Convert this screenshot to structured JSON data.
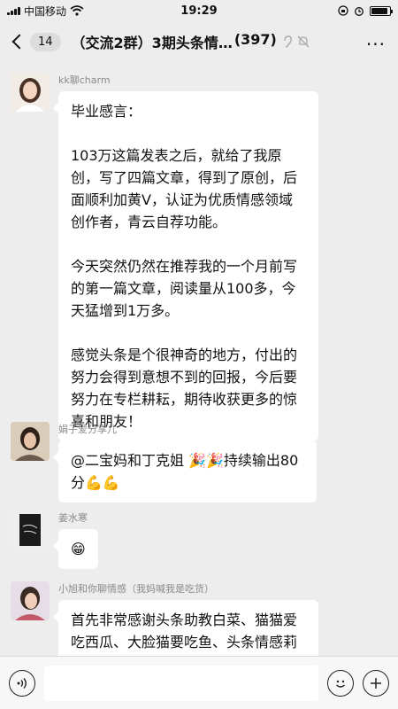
{
  "status_bar": {
    "carrier": "中国移动",
    "time": "19:29",
    "battery_percent": 90
  },
  "nav": {
    "unread_count": "14",
    "chat_title": "（交流2群）3期头条情…",
    "member_count": "(397)",
    "more_label": "···"
  },
  "messages": [
    {
      "sender": "kk聊charm",
      "text": "毕业感言：\n\n103万这篇发表之后，就给了我原创，写了四篇文章，得到了原创，后面顺利加黄V，认证为优质情感领域创作者，青云自荐功能。\n\n今天突然仍然在推荐我的一个月前写的第一篇文章，阅读量从100多，今天猛增到1万多。\n\n感觉头条是个很神奇的地方，付出的努力会得到意想不到的回报，今后要努力在专栏耕耘，期待收获更多的惊喜和朋友！"
    },
    {
      "sender": "娟子爱分享儿",
      "text": "@二宝妈和丁克姐 🎉🎉持续输出80分💪💪"
    },
    {
      "sender": "姜水寒",
      "text": "😁"
    },
    {
      "sender": "小旭和你聊情感（我妈喊我是吃货）",
      "text": "首先非常感谢头条助教白菜、猫猫爱吃西瓜、大脸猫要吃鱼、头条情感莉莉四位老师在我讲草培采培训"
    }
  ],
  "colors": {
    "chat_background": "#ededed",
    "bubble": "#ffffff"
  }
}
